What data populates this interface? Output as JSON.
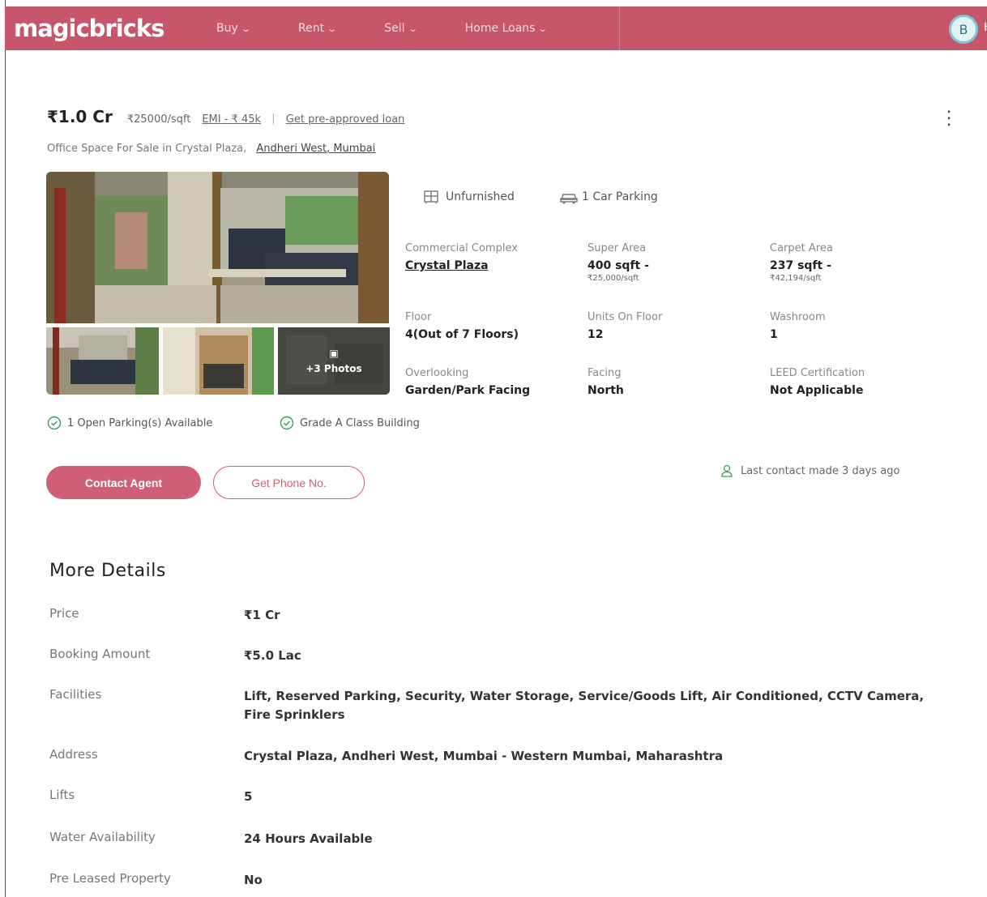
{
  "header": {
    "logo": "magicbricks",
    "nav": [
      {
        "label": "Buy"
      },
      {
        "label": "Rent"
      },
      {
        "label": "Sell"
      },
      {
        "label": "Home Loans"
      }
    ],
    "avatar_initial": "B",
    "avatar_trail": "H",
    "brand_color": "#c8566a"
  },
  "listing": {
    "price": "₹1.0 Cr",
    "price_per_sqft": "₹25000/sqft",
    "emi": "EMI - ₹ 45k",
    "separator": "|",
    "preapproved": "Get pre-approved loan",
    "subtitle_prefix": "Office Space For Sale in Crystal Plaza,",
    "subtitle_location": "Andheri West, Mumbai",
    "more_photos_icon": "▣",
    "more_photos": "+3 Photos",
    "amenities": [
      {
        "icon": "furniture-icon",
        "label": "Unfurnished"
      },
      {
        "icon": "car-icon",
        "label": "1 Car Parking"
      }
    ],
    "specs": {
      "complex": {
        "label": "Commercial Complex",
        "value": "Crystal Plaza"
      },
      "super_area": {
        "label": "Super Area",
        "value": "400 sqft -",
        "sub": "₹25,000/sqft"
      },
      "carpet_area": {
        "label": "Carpet Area",
        "value": "237 sqft -",
        "sub": "₹42,194/sqft"
      },
      "floor": {
        "label": "Floor",
        "value": "4(Out of 7 Floors)"
      },
      "units_on_floor": {
        "label": "Units On Floor",
        "value": "12"
      },
      "washroom": {
        "label": "Washroom",
        "value": "1"
      },
      "overlooking": {
        "label": "Overlooking",
        "value": "Garden/Park Facing"
      },
      "facing": {
        "label": "Facing",
        "value": "North"
      },
      "leed": {
        "label": "LEED Certification",
        "value": "Not Applicable"
      }
    },
    "features": [
      "1 Open Parking(s) Available",
      "Grade A Class Building"
    ],
    "contact_agent": "Contact Agent",
    "get_phone": "Get Phone No.",
    "last_contact": "Last contact made 3 days ago",
    "accent_color": "#cf5f75",
    "feature_icon_color": "#3a9d5a"
  },
  "more_details": {
    "title": "More Details",
    "rows": [
      {
        "key": "Price",
        "value": "₹1 Cr"
      },
      {
        "key": "Booking Amount",
        "value": "₹5.0 Lac"
      },
      {
        "key": "Facilities",
        "value": "Lift, Reserved Parking, Security, Water Storage, Service/Goods Lift, Air Conditioned, CCTV Camera, Fire Sprinklers"
      },
      {
        "key": "Address",
        "value": "Crystal Plaza, Andheri West, Mumbai - Western Mumbai, Maharashtra"
      },
      {
        "key": "Lifts",
        "value": "5"
      },
      {
        "key": "Water Availability",
        "value": "24 Hours Available"
      },
      {
        "key": "Pre Leased Property",
        "value": "No"
      }
    ]
  }
}
